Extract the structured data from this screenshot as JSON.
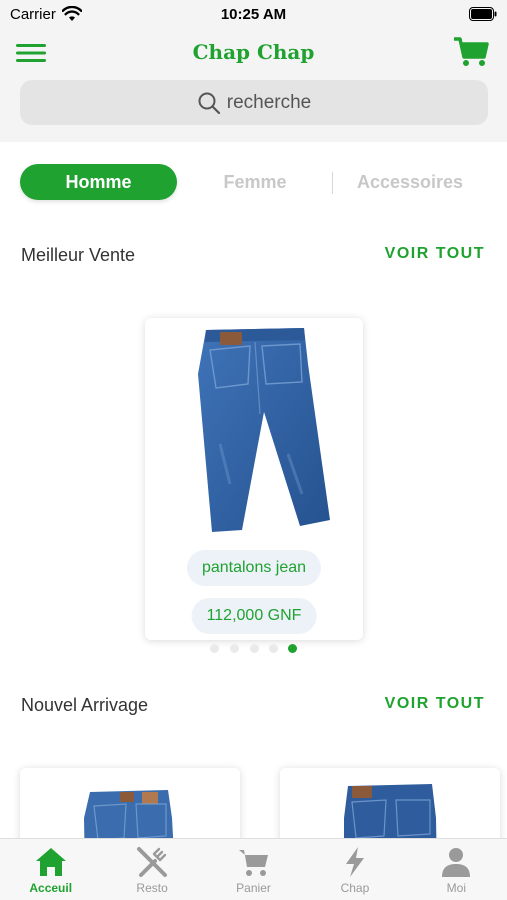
{
  "status_bar": {
    "carrier": "Carrier",
    "time": "10:25 AM"
  },
  "header": {
    "title": "Chap Chap"
  },
  "search": {
    "placeholder": "recherche"
  },
  "category_tabs": [
    {
      "label": "Homme",
      "active": true
    },
    {
      "label": "Femme",
      "active": false
    },
    {
      "label": "Accessoires",
      "active": false
    }
  ],
  "best_sellers": {
    "title": "Meilleur Vente",
    "see_all": "VOIR TOUT",
    "product": {
      "name": "pantalons jean",
      "price": "112,000 GNF"
    },
    "carousel": {
      "count": 5,
      "active_index": 4
    }
  },
  "new_arrivals": {
    "title": "Nouvel Arrivage",
    "see_all": "VOIR TOUT"
  },
  "bottom_nav": [
    {
      "label": "Acceuil",
      "icon": "home-icon",
      "active": true
    },
    {
      "label": "Resto",
      "icon": "utensils-icon",
      "active": false
    },
    {
      "label": "Panier",
      "icon": "cart-icon",
      "active": false
    },
    {
      "label": "Chap",
      "icon": "lightning-icon",
      "active": false
    },
    {
      "label": "Moi",
      "icon": "user-icon",
      "active": false
    }
  ],
  "colors": {
    "brand_green": "#1fa230",
    "inactive_gray": "#9a9a9a",
    "pill_bg": "#edf1f8",
    "denim": "#2f5fa3"
  }
}
